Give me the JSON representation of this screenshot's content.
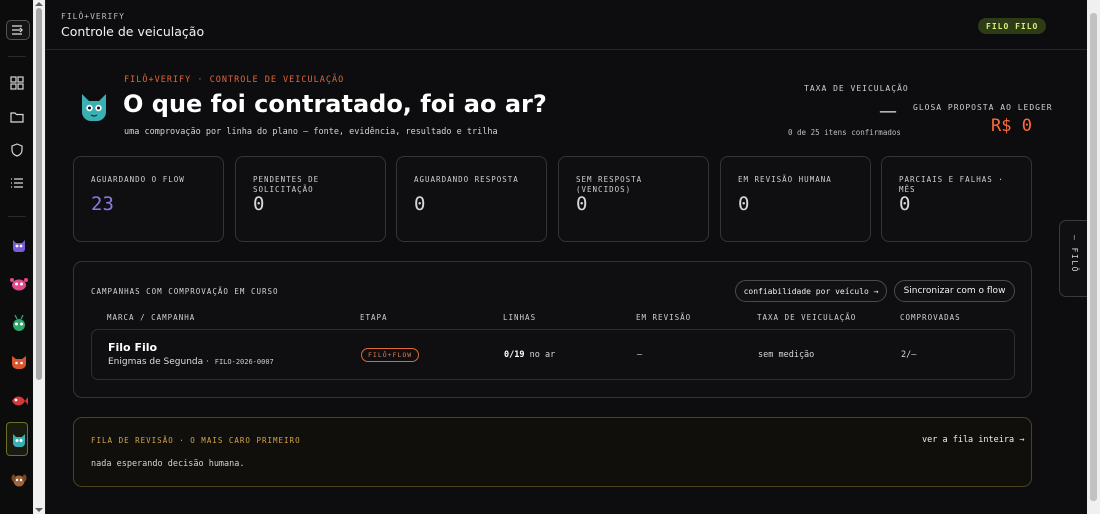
{
  "rail": {
    "items": [
      "panel-toggle-icon",
      "grid-icon",
      "folder-icon",
      "shield-icon",
      "list-icon"
    ],
    "avatars": [
      {
        "name": "purple-cat-avatar",
        "color": "#7a5cd6",
        "glyph": "🐱"
      },
      {
        "name": "pink-creature-avatar",
        "color": "#e04a8a",
        "glyph": "🐷"
      },
      {
        "name": "green-bug-avatar",
        "color": "#2fa66a",
        "glyph": "🐸"
      },
      {
        "name": "red-panda-avatar",
        "color": "#d9552b",
        "glyph": "🦊"
      },
      {
        "name": "red-fish-avatar",
        "color": "#d23a3a",
        "glyph": "🐟"
      },
      {
        "name": "teal-cat-avatar",
        "color": "#3ab0b5",
        "glyph": "🐱"
      },
      {
        "name": "brown-dog-avatar",
        "color": "#a0643a",
        "glyph": "🐶"
      }
    ]
  },
  "header": {
    "brand": "FILÔ+VERIFY",
    "title": "Controle de veiculação",
    "client_pill": "FILO FILO"
  },
  "hero": {
    "eyebrow": "FILÔ+VERIFY · CONTROLE DE VEICULAÇÃO",
    "title": "O que foi contratado, foi ao ar?",
    "subtitle": "uma comprovação por linha do plano — fonte, evidência, resultado e trilha"
  },
  "summary": {
    "rate_label": "TAXA DE VEICULAÇÃO",
    "rate_value": "—",
    "rate_note": "0 de 25 itens confirmados",
    "glosa_label": "GLOSA PROPOSTA AO LEDGER",
    "glosa_value": "R$ 0"
  },
  "stats": [
    {
      "label": "AGUARDANDO O FLOW",
      "value": "23"
    },
    {
      "label": "PENDENTES DE SOLICITAÇÃO",
      "value": "0"
    },
    {
      "label": "AGUARDANDO RESPOSTA",
      "value": "0"
    },
    {
      "label": "SEM RESPOSTA (VENCIDOS)",
      "value": "0"
    },
    {
      "label": "EM REVISÃO HUMANA",
      "value": "0"
    },
    {
      "label": "PARCIAIS E FALHAS · MÊS",
      "value": "0"
    }
  ],
  "campaigns": {
    "title": "CAMPANHAS COM COMPROVAÇÃO EM CURSO",
    "btn_reliability": "confiabilidade por veículo →",
    "btn_sync": "Sincronizar com o flow",
    "headers": [
      "MARCA / CAMPANHA",
      "ETAPA",
      "LINHAS",
      "EM REVISÃO",
      "TAXA DE VEICULAÇÃO",
      "COMPROVADAS"
    ],
    "rows": [
      {
        "brand": "Filo Filo",
        "campaign": "Enigmas de Segunda",
        "code": "FILO-2026-0007",
        "stage": "FILÔ+FLOW",
        "lines_count": "0/19",
        "lines_suffix": "no ar",
        "review": "—",
        "rate": "sem medição",
        "proven": "2/—"
      }
    ]
  },
  "queue": {
    "title": "FILA DE REVISÃO · O MAIS CARO PRIMEIRO",
    "link": "ver a fila inteira →",
    "empty": "nada esperando decisão humana."
  },
  "side_tab": {
    "label": "— FILÔ"
  }
}
